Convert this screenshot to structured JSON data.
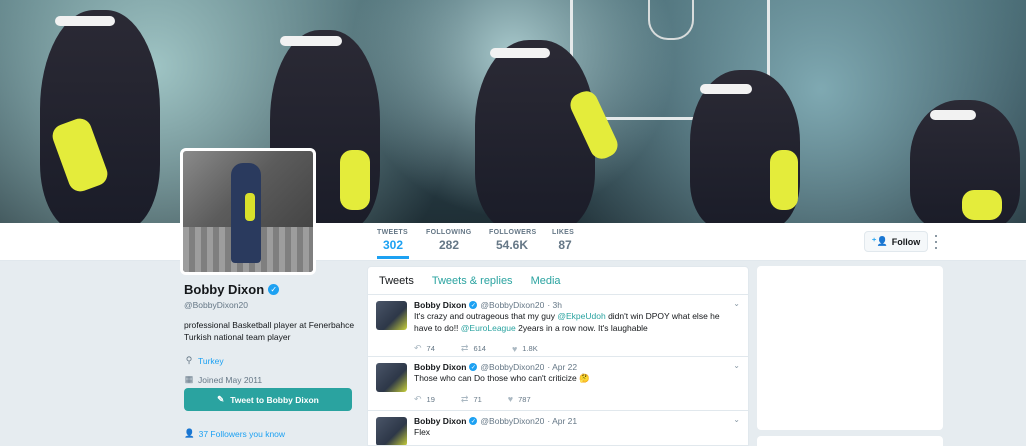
{
  "profile": {
    "name": "Bobby Dixon",
    "handle": "@BobbyDixon20",
    "bio": "professional Basketball player at Fenerbahce Turkish national team player",
    "location": "Turkey",
    "joined": "Joined May 2011",
    "tweet_to_label": "Tweet to Bobby Dixon",
    "followers_you_know": "37 Followers you know"
  },
  "stats": [
    {
      "label": "TWEETS",
      "value": "302"
    },
    {
      "label": "FOLLOWING",
      "value": "282"
    },
    {
      "label": "FOLLOWERS",
      "value": "54.6K"
    },
    {
      "label": "LIKES",
      "value": "87"
    }
  ],
  "follow_label": "Follow",
  "tabs": [
    "Tweets",
    "Tweets & replies",
    "Media"
  ],
  "tweets": [
    {
      "name": "Bobby Dixon",
      "handle": "@BobbyDixon20",
      "time": "· 3h",
      "text_parts": [
        "It's crazy and outrageous that my guy ",
        "@EkpeUdoh",
        " didn't win DPOY what else he have to do!! ",
        "@EuroLeague",
        " 2years in a row now. It's laughable"
      ],
      "replies": "74",
      "retweets": "614",
      "likes": "1.8K"
    },
    {
      "name": "Bobby Dixon",
      "handle": "@BobbyDixon20",
      "time": "· Apr 22",
      "text": "Those who can Do those who can't criticize 🤔",
      "replies": "19",
      "retweets": "71",
      "likes": "787"
    },
    {
      "name": "Bobby Dixon",
      "handle": "@BobbyDixon20",
      "time": "· Apr 21",
      "text": "Flex"
    }
  ],
  "colors": {
    "accent": "#1da1f2",
    "theme": "#2aa3a0",
    "background": "#e6ecf0"
  }
}
